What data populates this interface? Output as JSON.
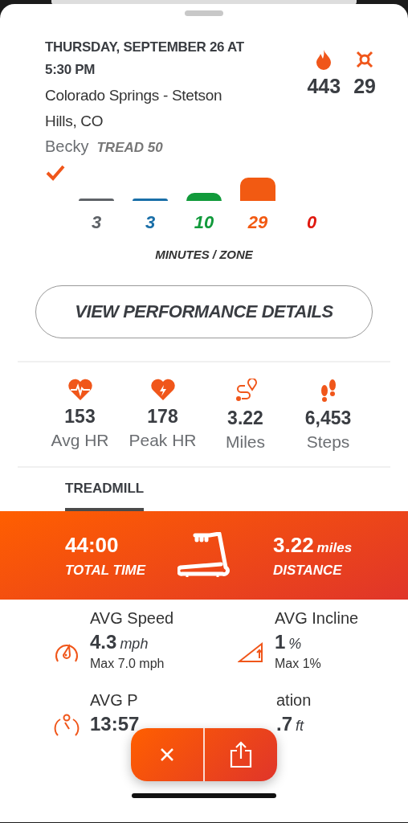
{
  "header": {
    "date": "THURSDAY, SEPTEMBER 26 AT 5:30 PM",
    "location": "Colorado Springs - Stetson Hills, CO",
    "coach": "Becky",
    "class_name": "TREAD 50",
    "completed": true
  },
  "totals": [
    {
      "kind": "calories",
      "value": "443"
    },
    {
      "kind": "splat",
      "value": "29"
    }
  ],
  "zones": [
    {
      "minutes": "3",
      "color": "#5f6368"
    },
    {
      "minutes": "3",
      "color": "#1a6fa8"
    },
    {
      "minutes": "10",
      "color": "#119a3b"
    },
    {
      "minutes": "29",
      "color": "#f25a12"
    },
    {
      "minutes": "0",
      "color": "#e0190f"
    }
  ],
  "zones_caption": "MINUTES / ZONE",
  "details_button": "VIEW PERFORMANCE DETAILS",
  "stats": [
    {
      "kind": "avg_hr",
      "value": "153",
      "label": "Avg HR"
    },
    {
      "kind": "peak_hr",
      "value": "178",
      "label": "Peak HR"
    },
    {
      "kind": "miles",
      "value": "3.22",
      "label": "Miles"
    },
    {
      "kind": "steps",
      "value": "6,453",
      "label": "Steps"
    }
  ],
  "tabs": [
    {
      "label": "TREADMILL",
      "selected": true
    }
  ],
  "banner": {
    "time": "44:00",
    "time_label": "TOTAL TIME",
    "distance": "3.22",
    "distance_unit": "miles",
    "distance_label": "DISTANCE"
  },
  "metrics": [
    {
      "kind": "speed",
      "label": "AVG Speed",
      "value": "4.3",
      "unit": "mph",
      "max": "Max 7.0 mph"
    },
    {
      "kind": "incline",
      "label": "AVG Incline",
      "value": "1",
      "unit": "%",
      "max": "Max 1%"
    },
    {
      "kind": "pace",
      "label": "AVG P",
      "value": "13:57"
    },
    {
      "kind": "elevation",
      "label": "ation",
      "value": ".7",
      "unit": "ft"
    }
  ]
}
